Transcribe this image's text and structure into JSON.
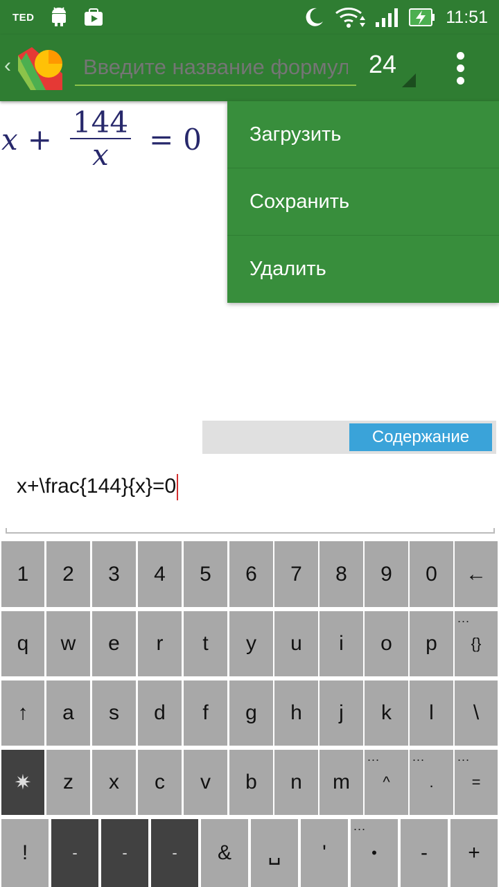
{
  "status": {
    "carrier": "TED",
    "time": "11:51"
  },
  "toolbar": {
    "name_placeholder": "Введите название формулы",
    "font_size": "24"
  },
  "formula": {
    "lhs_var": "x",
    "plus": "+",
    "numerator": "144",
    "denominator": "x",
    "equals": "=",
    "rhs": "0"
  },
  "menu": {
    "items": [
      "Загрузить",
      "Сохранить",
      "Удалить"
    ]
  },
  "content_button": "Содержание",
  "editor": {
    "value": "x+\\frac{144}{x}=0"
  },
  "keyboard": {
    "row1": [
      "1",
      "2",
      "3",
      "4",
      "5",
      "6",
      "7",
      "8",
      "9",
      "0",
      "←"
    ],
    "row2": [
      "q",
      "w",
      "e",
      "r",
      "t",
      "y",
      "u",
      "i",
      "o",
      "p",
      "{}"
    ],
    "row3": [
      "↑",
      "a",
      "s",
      "d",
      "f",
      "g",
      "h",
      "j",
      "k",
      "l",
      "\\"
    ],
    "row4": [
      "✷",
      "z",
      "x",
      "c",
      "v",
      "b",
      "n",
      "m",
      "^",
      ".",
      "="
    ],
    "row5": [
      "!",
      "-",
      "-",
      "-",
      "&",
      "␣",
      "'",
      "•",
      "-",
      "+"
    ],
    "more_hint": "..."
  },
  "colors": {
    "appbar": "#2f7d32",
    "menu": "#388e3c",
    "content_button": "#3aa3d9",
    "key": "#a8a8a8",
    "key_dark": "#414141"
  }
}
